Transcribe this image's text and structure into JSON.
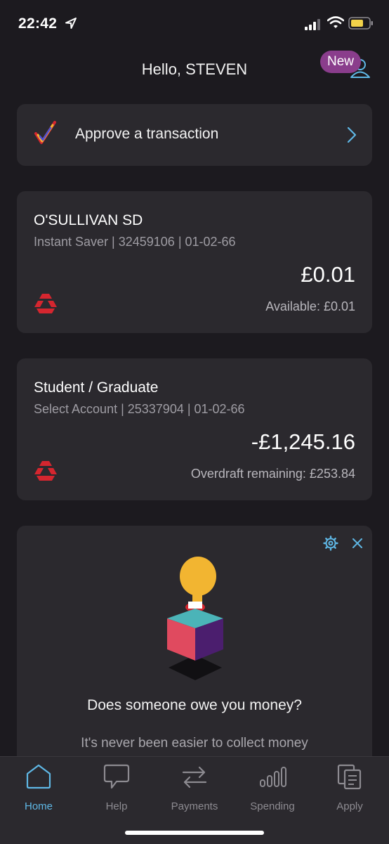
{
  "status_bar": {
    "time": "22:42"
  },
  "header": {
    "greeting": "Hello, STEVEN",
    "new_badge": "New"
  },
  "approve": {
    "label": "Approve a transaction"
  },
  "accounts": [
    {
      "name": "O'SULLIVAN SD",
      "details": "Instant Saver | 32459106 | 01-02-66",
      "balance": "£0.01",
      "sub": "Available: £0.01"
    },
    {
      "name": "Student / Graduate",
      "details": "Select Account | 25337904 | 01-02-66",
      "balance": "-£1,245.16",
      "sub": "Overdraft remaining: £253.84"
    }
  ],
  "promo": {
    "title": "Does someone owe you money?",
    "body": "It's never been easier to collect money"
  },
  "tabs": [
    {
      "label": "Home",
      "icon": "home-icon"
    },
    {
      "label": "Help",
      "icon": "chat-bubble-icon"
    },
    {
      "label": "Payments",
      "icon": "transfer-arrows-icon"
    },
    {
      "label": "Spending",
      "icon": "bar-chart-icon"
    },
    {
      "label": "Apply",
      "icon": "documents-icon"
    }
  ],
  "colors": {
    "accent": "#5fb8e6",
    "badge": "#8a3d8c",
    "background": "#1c1a1f",
    "card": "#2b292e",
    "natwest_red": "#d5262f"
  }
}
